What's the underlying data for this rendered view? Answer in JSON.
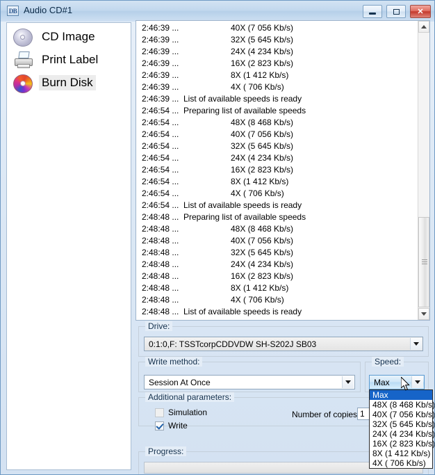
{
  "window": {
    "title": "Audio CD#1",
    "icon": "db-logo-icon",
    "controls": {
      "minimize": "minimize-button",
      "maximize": "maximize-button",
      "close": "close-button"
    }
  },
  "sidebar": {
    "items": [
      {
        "label": "CD Image",
        "icon": "cd-disc-icon",
        "selected": false
      },
      {
        "label": "Print Label",
        "icon": "printer-icon",
        "selected": false
      },
      {
        "label": "Burn Disk",
        "icon": "rainbow-disc-icon",
        "selected": true
      }
    ]
  },
  "log": {
    "rows": [
      {
        "time": "2:46:39 ...",
        "message": "40X (7 056 Kb/s)",
        "indent": true
      },
      {
        "time": "2:46:39 ...",
        "message": "32X (5 645 Kb/s)",
        "indent": true
      },
      {
        "time": "2:46:39 ...",
        "message": "24X (4 234 Kb/s)",
        "indent": true
      },
      {
        "time": "2:46:39 ...",
        "message": "16X (2 823 Kb/s)",
        "indent": true
      },
      {
        "time": "2:46:39 ...",
        "message": "8X (1 412 Kb/s)",
        "indent": true
      },
      {
        "time": "2:46:39 ...",
        "message": "4X ( 706 Kb/s)",
        "indent": true
      },
      {
        "time": "2:46:39 ...",
        "message": "List of available speeds is ready",
        "indent": false
      },
      {
        "time": "2:46:54 ...",
        "message": "Preparing list of available speeds",
        "indent": false
      },
      {
        "time": "2:46:54 ...",
        "message": "48X (8 468 Kb/s)",
        "indent": true
      },
      {
        "time": "2:46:54 ...",
        "message": "40X (7 056 Kb/s)",
        "indent": true
      },
      {
        "time": "2:46:54 ...",
        "message": "32X (5 645 Kb/s)",
        "indent": true
      },
      {
        "time": "2:46:54 ...",
        "message": "24X (4 234 Kb/s)",
        "indent": true
      },
      {
        "time": "2:46:54 ...",
        "message": "16X (2 823 Kb/s)",
        "indent": true
      },
      {
        "time": "2:46:54 ...",
        "message": "8X (1 412 Kb/s)",
        "indent": true
      },
      {
        "time": "2:46:54 ...",
        "message": "4X ( 706 Kb/s)",
        "indent": true
      },
      {
        "time": "2:46:54 ...",
        "message": "List of available speeds is ready",
        "indent": false
      },
      {
        "time": "2:48:48 ...",
        "message": "Preparing list of available speeds",
        "indent": false
      },
      {
        "time": "2:48:48 ...",
        "message": "48X (8 468 Kb/s)",
        "indent": true
      },
      {
        "time": "2:48:48 ...",
        "message": "40X (7 056 Kb/s)",
        "indent": true
      },
      {
        "time": "2:48:48 ...",
        "message": "32X (5 645 Kb/s)",
        "indent": true
      },
      {
        "time": "2:48:48 ...",
        "message": "24X (4 234 Kb/s)",
        "indent": true
      },
      {
        "time": "2:48:48 ...",
        "message": "16X (2 823 Kb/s)",
        "indent": true
      },
      {
        "time": "2:48:48 ...",
        "message": "8X (1 412 Kb/s)",
        "indent": true
      },
      {
        "time": "2:48:48 ...",
        "message": "4X ( 706 Kb/s)",
        "indent": true
      },
      {
        "time": "2:48:48 ...",
        "message": "List of available speeds is ready",
        "indent": false
      }
    ]
  },
  "drive": {
    "legend": "Drive:",
    "value": "0:1:0,F: TSSTcorpCDDVDW SH-S202J SB03"
  },
  "write_method": {
    "legend": "Write method:",
    "value": "Session At Once"
  },
  "speed": {
    "legend": "Speed:",
    "value": "Max",
    "open": true,
    "options": [
      "Max",
      "48X (8 468 Kb/s)",
      "40X (7 056 Kb/s)",
      "32X (5 645 Kb/s)",
      "24X (4 234 Kb/s)",
      "16X (2 823 Kb/s)",
      "8X (1 412 Kb/s)",
      "4X ( 706 Kb/s)"
    ],
    "selected_index": 0
  },
  "additional_parameters": {
    "legend": "Additional parameters:",
    "simulation_label": "Simulation",
    "simulation_checked": false,
    "write_label": "Write",
    "write_checked": true,
    "copies_label": "Number of copies:",
    "copies_value": "1"
  },
  "progress": {
    "legend": "Progress:"
  },
  "colors": {
    "titlebar_accent": "#b6d0e9",
    "selection_blue": "#1664c8",
    "close_red": "#c4392c",
    "window_bg": "#e4edf7"
  }
}
